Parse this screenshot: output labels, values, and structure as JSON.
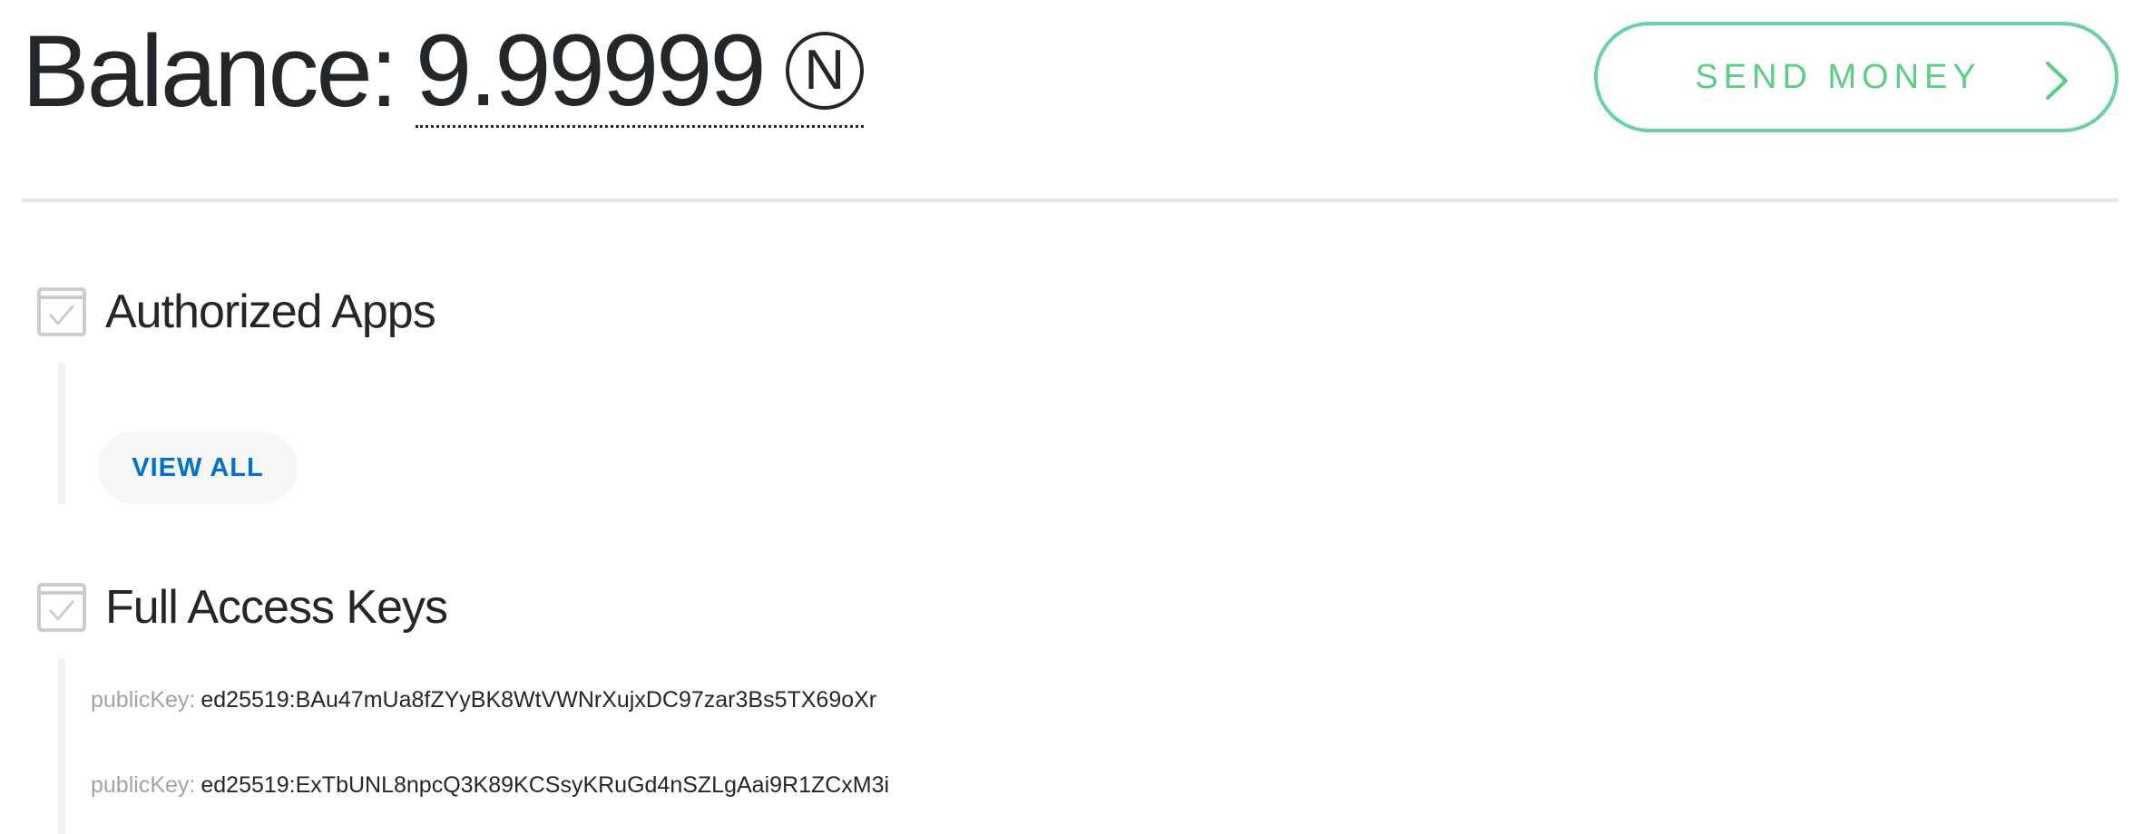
{
  "header": {
    "balance_label": "Balance:",
    "balance_value": "9.99999",
    "currency_symbol": "N",
    "send_button_label": "SEND MONEY"
  },
  "sections": {
    "authorized_apps": {
      "title": "Authorized Apps",
      "view_all_label": "VIEW ALL"
    },
    "full_access_keys": {
      "title": "Full Access Keys",
      "keys": [
        {
          "label": "publicKey:",
          "value": "ed25519:BAu47mUa8fZYyBK8WtVWNrXujxDC97zar3Bs5TX69oXr"
        },
        {
          "label": "publicKey:",
          "value": "ed25519:ExTbUNL8npcQ3K89KCSsyKRuGd4nSZLgAai9R1ZCxM3i"
        }
      ]
    }
  },
  "colors": {
    "accent_green": "#5ace84",
    "link_blue": "#0072ce",
    "text_dark": "#24272a",
    "muted": "#a2a2a8"
  },
  "icons": {
    "currency": "near-currency-icon",
    "send_chevron": "chevron-right-icon",
    "section_check": "checkbox-icon"
  }
}
